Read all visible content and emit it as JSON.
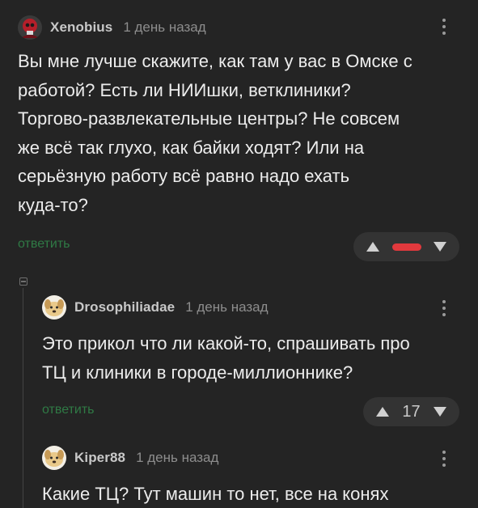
{
  "comments": [
    {
      "username": "Xenobius",
      "timestamp": "1 день назад",
      "avatar_icon": "skull-avatar",
      "body_lines": [
        "Вы мне лучше скажите, как там у вас в Омске с",
        "работой? Есть ли НИИшки, ветклиники?",
        "Торгово-развлекательные центры? Не совсем",
        "же всё так глухо, как байки ходят? Или на",
        "серьёзную работу всё равно надо ехать",
        "куда-то?"
      ],
      "reply_label": "ответить",
      "rating_state": "negative",
      "rating_color": "#e2393d"
    },
    {
      "username": "Drosophiliadae",
      "timestamp": "1 день назад",
      "avatar_icon": "dog-avatar",
      "body_lines": [
        "Это прикол что ли какой-то, спрашивать про",
        "ТЦ и клиники в городе-миллионнике?"
      ],
      "reply_label": "ответить",
      "rating": "17"
    },
    {
      "username": "Kiper88",
      "timestamp": "1 день назад",
      "avatar_icon": "dog-avatar",
      "body_lines": [
        "Какие ТЦ? Тут машин то нет, все на конях"
      ]
    }
  ],
  "colors": {
    "background": "#242424",
    "text": "#ececec",
    "reply_link": "#2f7a45",
    "vote_pill": "#333333",
    "negative": "#e2393d"
  }
}
